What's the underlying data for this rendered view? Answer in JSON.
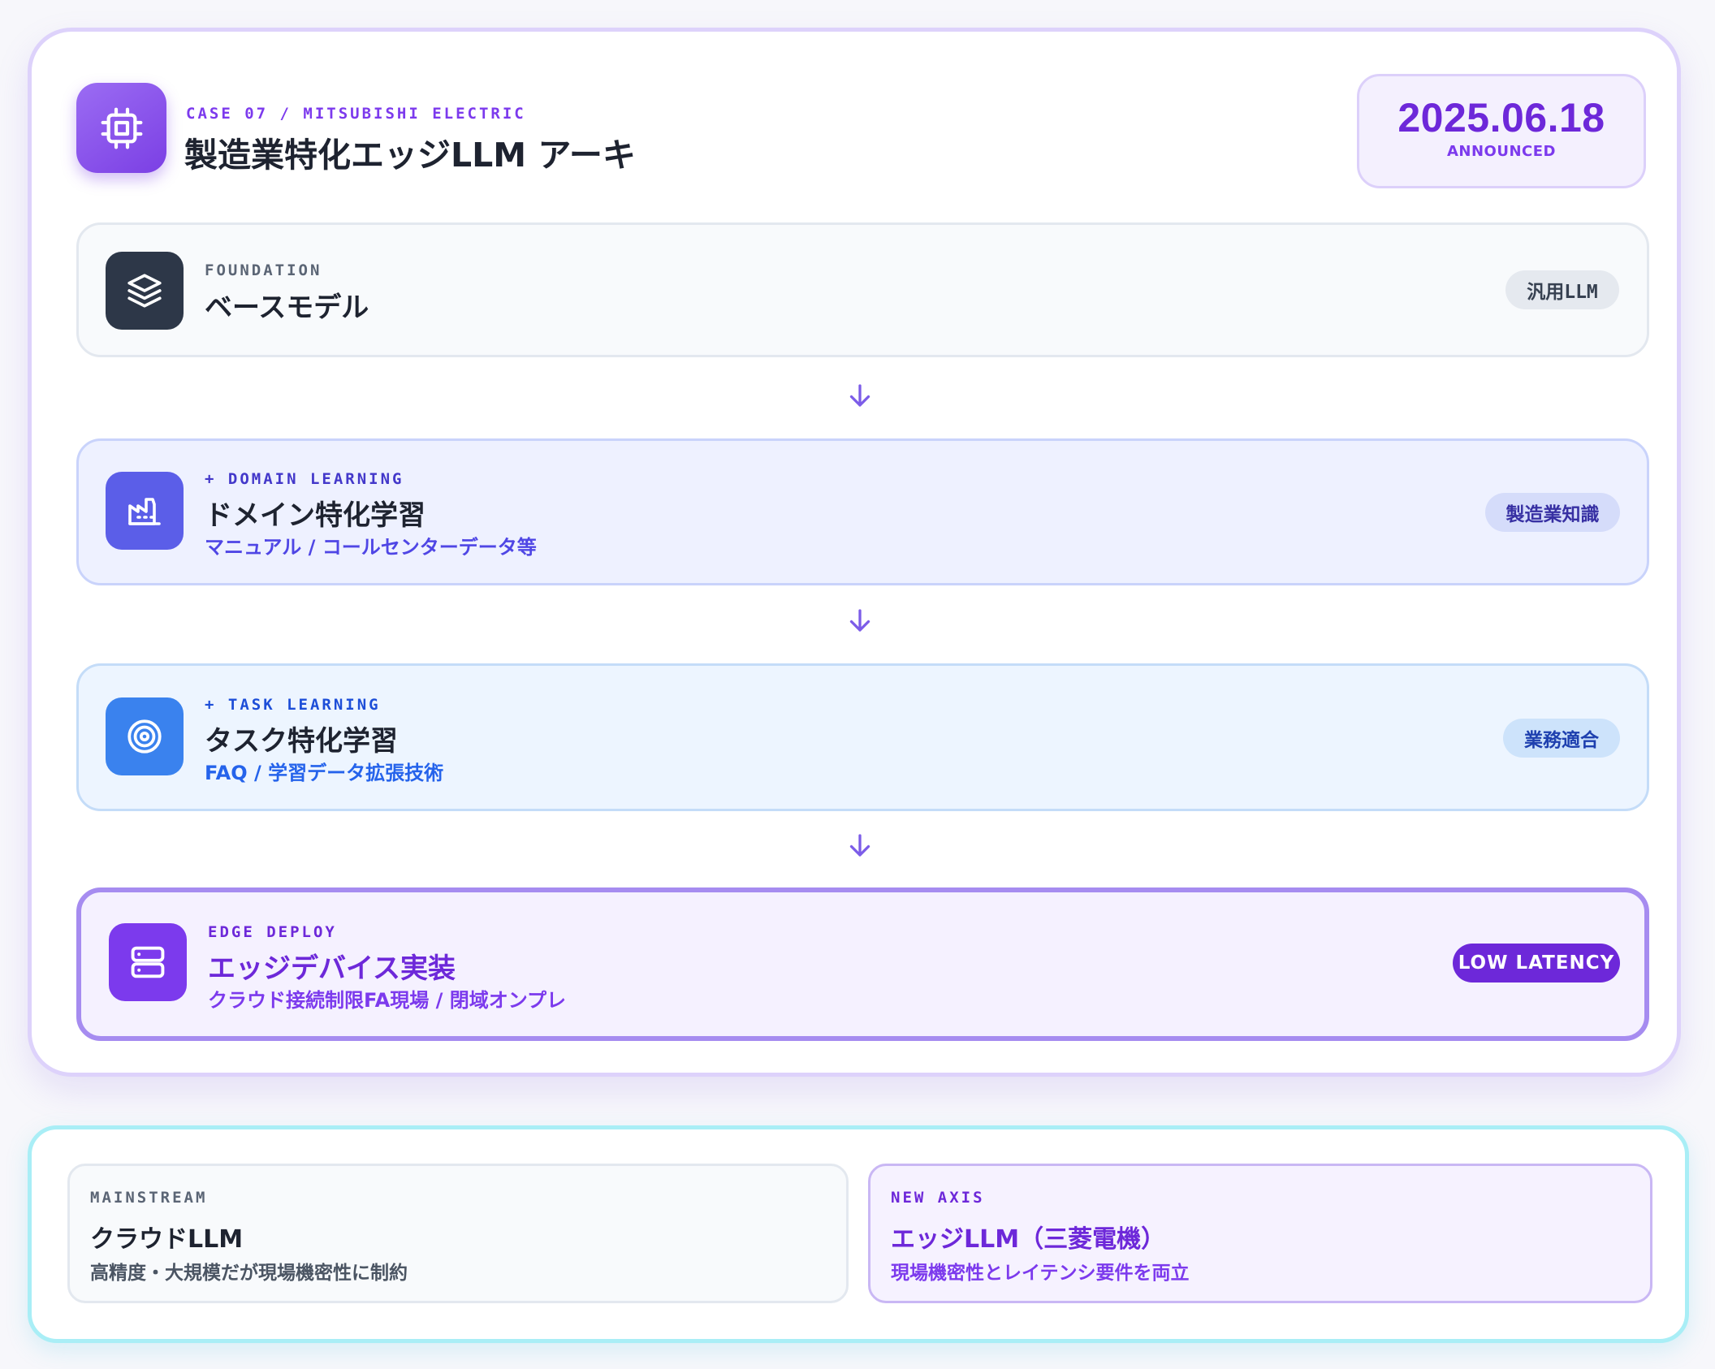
{
  "header": {
    "eyebrow": "CASE 07 / MITSUBISHI ELECTRIC",
    "title": "製造業特化エッジLLM アーキ",
    "icon": "chip-icon",
    "date": "2025.06.18",
    "date_label": "ANNOUNCED"
  },
  "stages": [
    {
      "eyebrow": "FOUNDATION",
      "title": "ベースモデル",
      "subtitle": "",
      "tag": "汎用LLM",
      "icon": "layers-icon"
    },
    {
      "eyebrow": "+ DOMAIN LEARNING",
      "title": "ドメイン特化学習",
      "subtitle": "マニュアル / コールセンターデータ等",
      "tag": "製造業知識",
      "icon": "factory-icon"
    },
    {
      "eyebrow": "+ TASK LEARNING",
      "title": "タスク特化学習",
      "subtitle": "FAQ / 学習データ拡張技術",
      "tag": "業務適合",
      "icon": "target-icon"
    },
    {
      "eyebrow": "EDGE DEPLOY",
      "title": "エッジデバイス実装",
      "subtitle": "クラウド接続制限FA現場 / 閉域オンプレ",
      "tag": "LOW LATENCY",
      "icon": "server-icon"
    }
  ],
  "comparison": {
    "left": {
      "eyebrow": "MAINSTREAM",
      "title": "クラウドLLM",
      "description": "高精度・大規模だが現場機密性に制約"
    },
    "right": {
      "eyebrow": "NEW AXIS",
      "title": "エッジLLM（三菱電機）",
      "description": "現場機密性とレイテンシ要件を両立"
    }
  },
  "colors": {
    "accent_purple": "#7c3aed",
    "domain_indigo": "#4f46e5",
    "task_blue": "#2563eb",
    "dark_slate": "#2d3748",
    "compare_border": "#a9eef6"
  }
}
